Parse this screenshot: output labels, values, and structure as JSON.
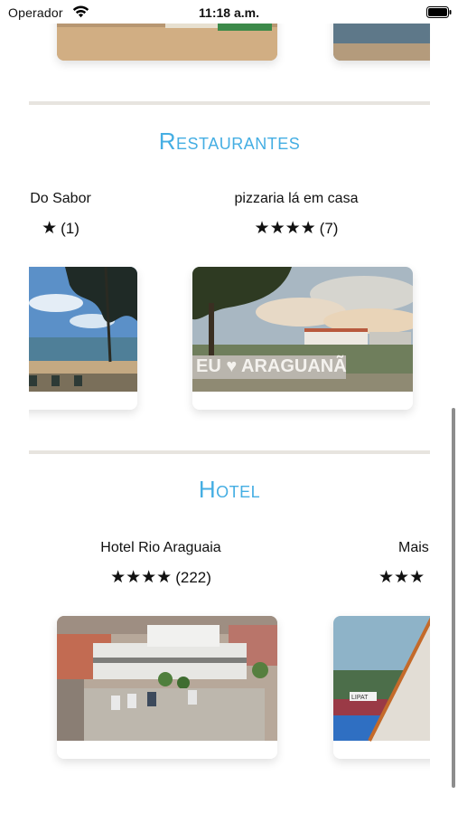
{
  "status_bar": {
    "carrier": "Operador",
    "time": "11:18 a.m.",
    "wifi_icon": "wifi-icon",
    "battery_icon": "battery-icon"
  },
  "sections": {
    "restaurantes": {
      "title": "Restaurantes",
      "items": [
        {
          "name": "Do Sabor",
          "stars": "★",
          "count": "(1)"
        },
        {
          "name": "pizzaria lá em casa",
          "stars": "★★★★",
          "count": "(7)"
        }
      ]
    },
    "hotel": {
      "title": "Hotel",
      "items": [
        {
          "name": "Hotel Rio Araguaia",
          "stars": "★★★★",
          "count": "(222)"
        },
        {
          "name": "Mais",
          "stars": "★★★",
          "count": ""
        }
      ]
    }
  },
  "images": {
    "sign_text": "EU ♥ ARAGUANÃ",
    "pool_sign_text": "LIPAT"
  },
  "colors": {
    "accent": "#45aee3",
    "divider": "#e7e4df"
  }
}
